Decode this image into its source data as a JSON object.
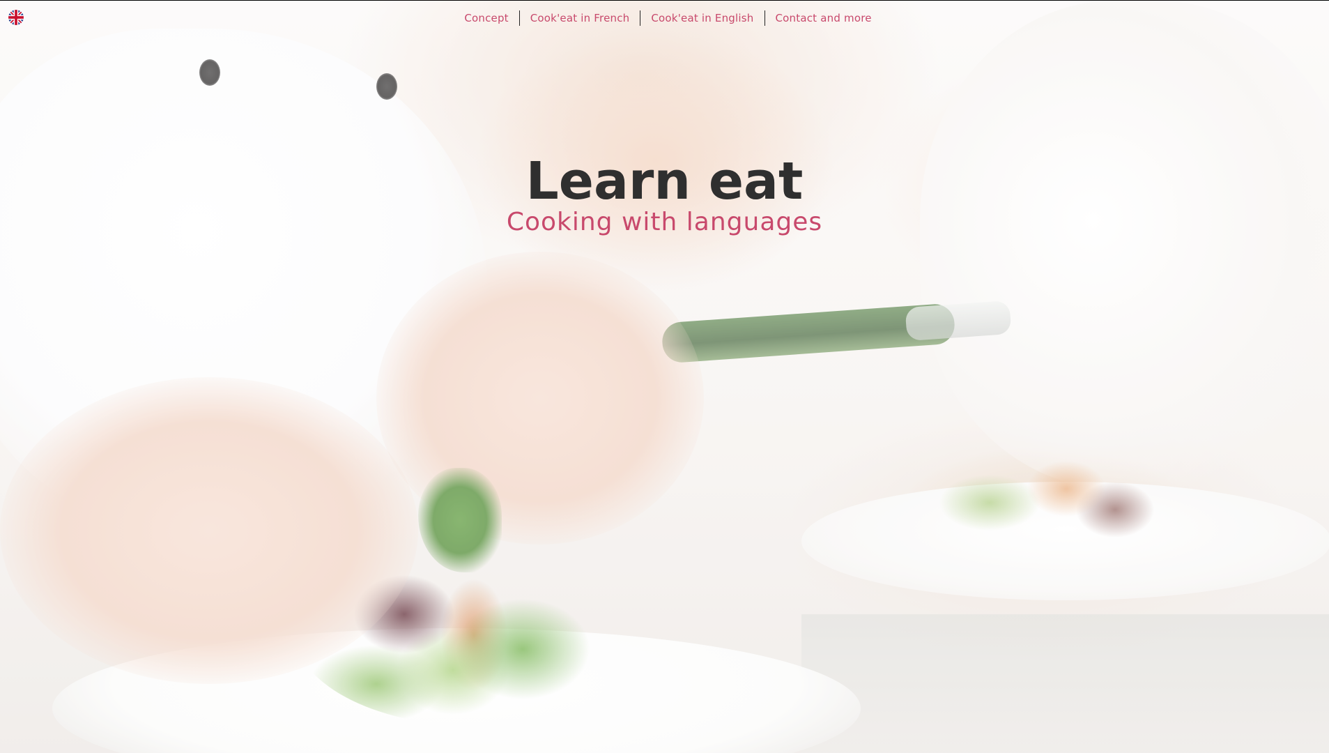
{
  "language_switch": {
    "icon": "uk-flag-icon"
  },
  "nav": {
    "items": [
      {
        "label": "Concept"
      },
      {
        "label": "Cook'eat in French"
      },
      {
        "label": "Cook'eat in English"
      },
      {
        "label": "Contact and more"
      }
    ]
  },
  "hero": {
    "title": "Learn eat",
    "subtitle": "Cooking with languages"
  },
  "colors": {
    "accent": "#c8496c",
    "title": "#2f2f2f",
    "separator": "#222222"
  }
}
